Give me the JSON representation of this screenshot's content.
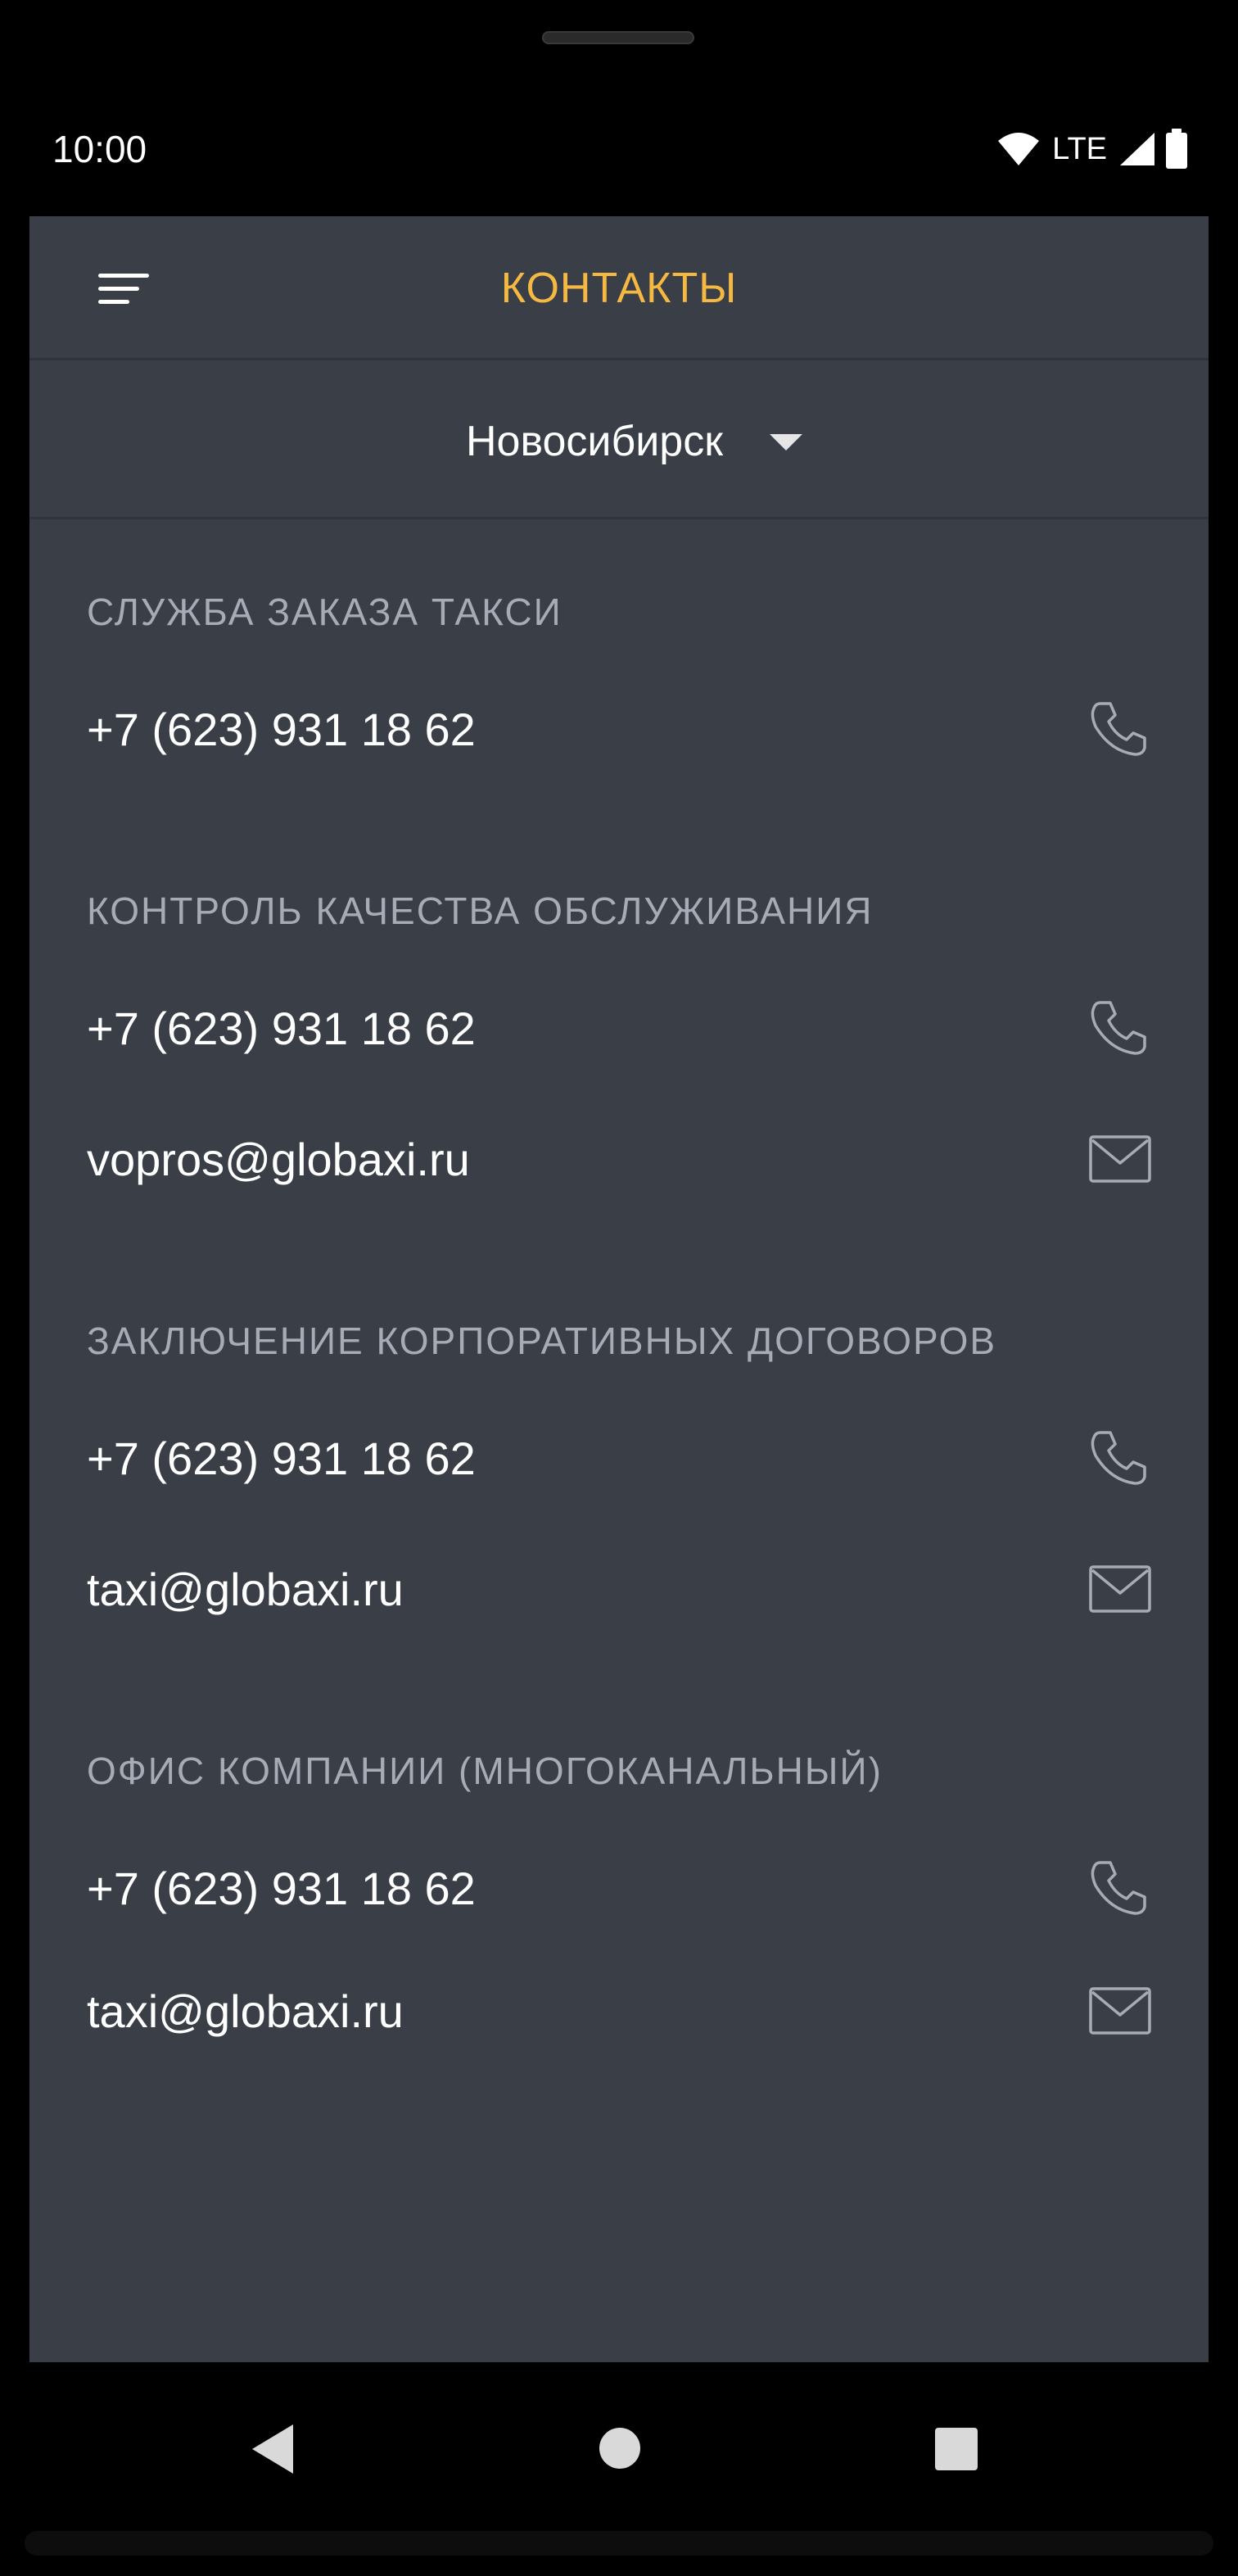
{
  "status_bar": {
    "time": "10:00",
    "network_label": "LTE",
    "icons": [
      "wifi-icon",
      "signal-icon",
      "battery-icon"
    ]
  },
  "header": {
    "title": "КОНТАКТЫ",
    "menu_icon": "menu-icon",
    "title_color": "#f5b942"
  },
  "city": {
    "name": "Новосибирск",
    "dropdown_icon": "dropdown-arrow-icon"
  },
  "sections": [
    {
      "title": "СЛУЖБА ЗАКАЗА ТАКСИ",
      "contacts": [
        {
          "type": "phone",
          "value": "+7 (623) 931 18 62",
          "icon": "phone-icon"
        }
      ]
    },
    {
      "title": "КОНТРОЛЬ КАЧЕСТВА ОБСЛУЖИВАНИЯ",
      "contacts": [
        {
          "type": "phone",
          "value": "+7 (623) 931 18 62",
          "icon": "phone-icon"
        },
        {
          "type": "email",
          "value": "vopros@globaxi.ru",
          "icon": "mail-icon"
        }
      ]
    },
    {
      "title": "ЗАКЛЮЧЕНИЕ КОРПОРАТИВНЫХ ДОГОВОРОВ",
      "contacts": [
        {
          "type": "phone",
          "value": "+7 (623) 931 18 62",
          "icon": "phone-icon"
        },
        {
          "type": "email",
          "value": "taxi@globaxi.ru",
          "icon": "mail-icon"
        }
      ]
    },
    {
      "title": "ОФИС КОМПАНИИ (МНОГОКАНАЛЬНЫЙ)",
      "contacts": [
        {
          "type": "phone",
          "value": "+7 (623) 931 18 62",
          "icon": "phone-icon"
        },
        {
          "type": "email",
          "value": "taxi@globaxi.ru",
          "icon": "mail-icon"
        }
      ]
    }
  ],
  "nav_bar": {
    "icons": [
      "back-icon",
      "home-icon",
      "recents-icon"
    ]
  },
  "colors": {
    "background": "#3a3e47",
    "section_title": "#a7abb5",
    "text": "#ffffff",
    "accent": "#f5b942"
  }
}
